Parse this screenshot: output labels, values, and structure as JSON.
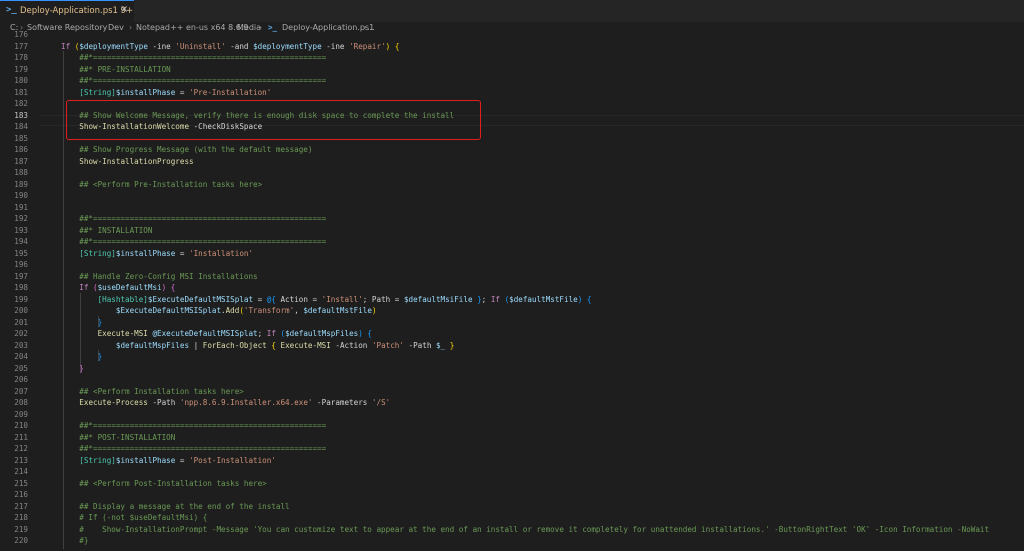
{
  "tab": {
    "icon": "powershell-icon",
    "title": "Deploy-Application.ps1",
    "count": "9+",
    "close": "×"
  },
  "breadcrumb": [
    "C:",
    "Software Repository",
    "Dev",
    "Notepad++ en-us x64 8.6.9",
    "Media",
    "Deploy-Application.ps1",
    "..."
  ],
  "breadcrumb_sep": "›",
  "lines": [
    {
      "n": "176",
      "tokens": []
    },
    {
      "n": "177",
      "tokens": [
        [
          "kw",
          "If"
        ],
        [
          "op",
          " "
        ],
        [
          "br1",
          "("
        ],
        [
          "var",
          "$deploymentType"
        ],
        [
          "op",
          " -ine "
        ],
        [
          "str",
          "'Uninstall'"
        ],
        [
          "op",
          " -and "
        ],
        [
          "var",
          "$deploymentType"
        ],
        [
          "op",
          " -ine "
        ],
        [
          "str",
          "'Repair'"
        ],
        [
          "br1",
          ")"
        ],
        [
          "op",
          " "
        ],
        [
          "br1",
          "{"
        ]
      ]
    },
    {
      "n": "178",
      "tokens": [
        [
          "cmt",
          "    ##*==================================================="
        ]
      ]
    },
    {
      "n": "179",
      "tokens": [
        [
          "cmt",
          "    ##* PRE-INSTALLATION"
        ]
      ]
    },
    {
      "n": "180",
      "tokens": [
        [
          "cmt",
          "    ##*==================================================="
        ]
      ]
    },
    {
      "n": "181",
      "tokens": [
        [
          "op",
          "    "
        ],
        [
          "type",
          "[String]"
        ],
        [
          "var",
          "$installPhase"
        ],
        [
          "op",
          " = "
        ],
        [
          "str",
          "'Pre-Installation'"
        ]
      ]
    },
    {
      "n": "182",
      "tokens": []
    },
    {
      "n": "183",
      "tokens": [
        [
          "cmt",
          "    ## Show Welcome Message, verify there is enough disk space to complete the install"
        ]
      ]
    },
    {
      "n": "184",
      "tokens": [
        [
          "op",
          "    "
        ],
        [
          "fn",
          "Show-InstallationWelcome"
        ],
        [
          "prm",
          " -CheckDiskSpace"
        ]
      ]
    },
    {
      "n": "185",
      "tokens": []
    },
    {
      "n": "186",
      "tokens": [
        [
          "cmt",
          "    ## Show Progress Message (with the default message)"
        ]
      ]
    },
    {
      "n": "187",
      "tokens": [
        [
          "op",
          "    "
        ],
        [
          "fn",
          "Show-InstallationProgress"
        ]
      ]
    },
    {
      "n": "188",
      "tokens": []
    },
    {
      "n": "189",
      "tokens": [
        [
          "cmt",
          "    ## <Perform Pre-Installation tasks here>"
        ]
      ]
    },
    {
      "n": "190",
      "tokens": []
    },
    {
      "n": "191",
      "tokens": []
    },
    {
      "n": "192",
      "tokens": [
        [
          "cmt",
          "    ##*==================================================="
        ]
      ]
    },
    {
      "n": "193",
      "tokens": [
        [
          "cmt",
          "    ##* INSTALLATION"
        ]
      ]
    },
    {
      "n": "194",
      "tokens": [
        [
          "cmt",
          "    ##*==================================================="
        ]
      ]
    },
    {
      "n": "195",
      "tokens": [
        [
          "op",
          "    "
        ],
        [
          "type",
          "[String]"
        ],
        [
          "var",
          "$installPhase"
        ],
        [
          "op",
          " = "
        ],
        [
          "str",
          "'Installation'"
        ]
      ]
    },
    {
      "n": "196",
      "tokens": []
    },
    {
      "n": "197",
      "tokens": [
        [
          "cmt",
          "    ## Handle Zero-Config MSI Installations"
        ]
      ]
    },
    {
      "n": "198",
      "tokens": [
        [
          "op",
          "    "
        ],
        [
          "kw",
          "If"
        ],
        [
          "op",
          " "
        ],
        [
          "br2",
          "("
        ],
        [
          "var",
          "$useDefaultMsi"
        ],
        [
          "br2",
          ")"
        ],
        [
          "op",
          " "
        ],
        [
          "br2",
          "{"
        ]
      ]
    },
    {
      "n": "199",
      "tokens": [
        [
          "op",
          "        "
        ],
        [
          "type",
          "[Hashtable]"
        ],
        [
          "var",
          "$ExecuteDefaultMSISplat"
        ],
        [
          "op",
          " = "
        ],
        [
          "br3",
          "@{"
        ],
        [
          "op",
          " Action = "
        ],
        [
          "str",
          "'Install'"
        ],
        [
          "op",
          "; Path = "
        ],
        [
          "var",
          "$defaultMsiFile"
        ],
        [
          "op",
          " "
        ],
        [
          "br3",
          "}"
        ],
        [
          "op",
          "; "
        ],
        [
          "kw",
          "If"
        ],
        [
          "op",
          " "
        ],
        [
          "br3",
          "("
        ],
        [
          "var",
          "$defaultMstFile"
        ],
        [
          "br3",
          ")"
        ],
        [
          "op",
          " "
        ],
        [
          "br3",
          "{"
        ]
      ]
    },
    {
      "n": "200",
      "tokens": [
        [
          "op",
          "            "
        ],
        [
          "var",
          "$ExecuteDefaultMSISplat"
        ],
        [
          "op",
          "."
        ],
        [
          "fn",
          "Add"
        ],
        [
          "br1",
          "("
        ],
        [
          "str",
          "'Transform'"
        ],
        [
          "op",
          ", "
        ],
        [
          "var",
          "$defaultMstFile"
        ],
        [
          "br1",
          ")"
        ]
      ]
    },
    {
      "n": "201",
      "tokens": [
        [
          "op",
          "        "
        ],
        [
          "br3",
          "}"
        ]
      ]
    },
    {
      "n": "202",
      "tokens": [
        [
          "op",
          "        "
        ],
        [
          "fn",
          "Execute-MSI"
        ],
        [
          "op",
          " "
        ],
        [
          "var",
          "@ExecuteDefaultMSISplat"
        ],
        [
          "op",
          "; "
        ],
        [
          "kw",
          "If"
        ],
        [
          "op",
          " "
        ],
        [
          "br3",
          "("
        ],
        [
          "var",
          "$defaultMspFiles"
        ],
        [
          "br3",
          ")"
        ],
        [
          "op",
          " "
        ],
        [
          "br3",
          "{"
        ]
      ]
    },
    {
      "n": "203",
      "tokens": [
        [
          "op",
          "            "
        ],
        [
          "var",
          "$defaultMspFiles"
        ],
        [
          "op",
          " | "
        ],
        [
          "fn",
          "ForEach-Object"
        ],
        [
          "op",
          " "
        ],
        [
          "br1",
          "{"
        ],
        [
          "op",
          " "
        ],
        [
          "fn",
          "Execute-MSI"
        ],
        [
          "prm",
          " -Action "
        ],
        [
          "str",
          "'Patch'"
        ],
        [
          "prm",
          " -Path "
        ],
        [
          "var",
          "$_"
        ],
        [
          "op",
          " "
        ],
        [
          "br1",
          "}"
        ]
      ]
    },
    {
      "n": "204",
      "tokens": [
        [
          "op",
          "        "
        ],
        [
          "br3",
          "}"
        ]
      ]
    },
    {
      "n": "205",
      "tokens": [
        [
          "op",
          "    "
        ],
        [
          "br2",
          "}"
        ]
      ]
    },
    {
      "n": "206",
      "tokens": []
    },
    {
      "n": "207",
      "tokens": [
        [
          "cmt",
          "    ## <Perform Installation tasks here>"
        ]
      ]
    },
    {
      "n": "208",
      "tokens": [
        [
          "op",
          "    "
        ],
        [
          "fn",
          "Execute-Process"
        ],
        [
          "prm",
          " -Path "
        ],
        [
          "str",
          "'npp.8.6.9.Installer.x64.exe'"
        ],
        [
          "prm",
          " -Parameters "
        ],
        [
          "str",
          "'/S'"
        ]
      ]
    },
    {
      "n": "209",
      "tokens": []
    },
    {
      "n": "210",
      "tokens": [
        [
          "cmt",
          "    ##*==================================================="
        ]
      ]
    },
    {
      "n": "211",
      "tokens": [
        [
          "cmt",
          "    ##* POST-INSTALLATION"
        ]
      ]
    },
    {
      "n": "212",
      "tokens": [
        [
          "cmt",
          "    ##*==================================================="
        ]
      ]
    },
    {
      "n": "213",
      "tokens": [
        [
          "op",
          "    "
        ],
        [
          "type",
          "[String]"
        ],
        [
          "var",
          "$installPhase"
        ],
        [
          "op",
          " = "
        ],
        [
          "str",
          "'Post-Installation'"
        ]
      ]
    },
    {
      "n": "214",
      "tokens": []
    },
    {
      "n": "215",
      "tokens": [
        [
          "cmt",
          "    ## <Perform Post-Installation tasks here>"
        ]
      ]
    },
    {
      "n": "216",
      "tokens": []
    },
    {
      "n": "217",
      "tokens": [
        [
          "cmt",
          "    ## Display a message at the end of the install"
        ]
      ]
    },
    {
      "n": "218",
      "tokens": [
        [
          "cmt",
          "    # If (-not $useDefaultMsi) {"
        ]
      ]
    },
    {
      "n": "219",
      "tokens": [
        [
          "cmt",
          "    #    Show-InstallationPrompt -Message 'You can customize text to appear at the end of an install or remove it completely for unattended installations.' -ButtonRightText 'OK' -Icon Information -NoWait"
        ]
      ]
    },
    {
      "n": "220",
      "tokens": [
        [
          "cmt",
          "    #}"
        ]
      ]
    }
  ],
  "colors": {
    "background": "#1e1e1e",
    "highlight_box": "#e01e1e",
    "tab_title": "#e2c08d"
  }
}
